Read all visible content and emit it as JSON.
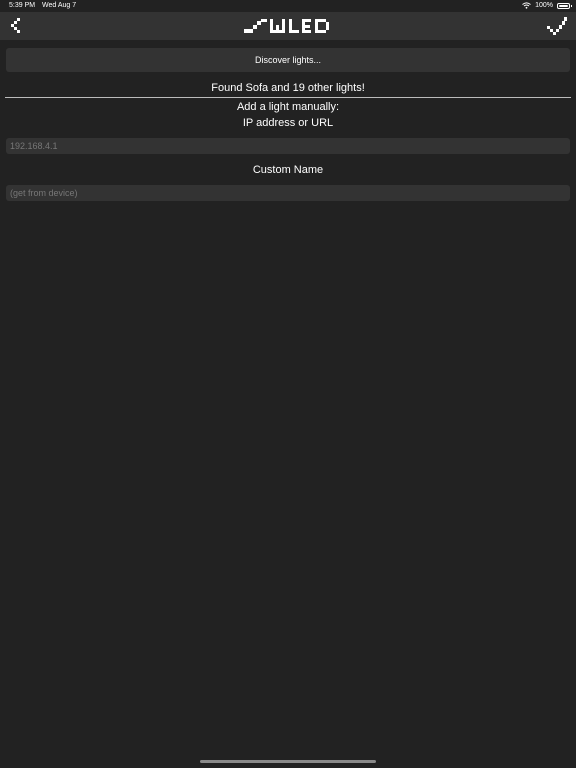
{
  "status_bar": {
    "time": "5:39 PM",
    "date": "Wed Aug 7",
    "battery_percent": "100%",
    "battery_level": 1.0,
    "icons": [
      "wifi-icon",
      "battery-icon"
    ]
  },
  "nav": {
    "back_icon": "chevron-left-icon",
    "logo": "WLED",
    "done_icon": "checkmark-icon"
  },
  "discover": {
    "label": "Discover lights..."
  },
  "found_text": "Found Sofa and 19 other lights!",
  "manual": {
    "title": "Add a light manually:",
    "ip_label": "IP address or URL",
    "ip_placeholder": "192.168.4.1",
    "ip_value": "",
    "name_label": "Custom Name",
    "name_placeholder": "(get from device)",
    "name_value": ""
  },
  "colors": {
    "background": "#222222",
    "bar": "#333333",
    "text": "#ffffff",
    "placeholder": "#777777"
  }
}
